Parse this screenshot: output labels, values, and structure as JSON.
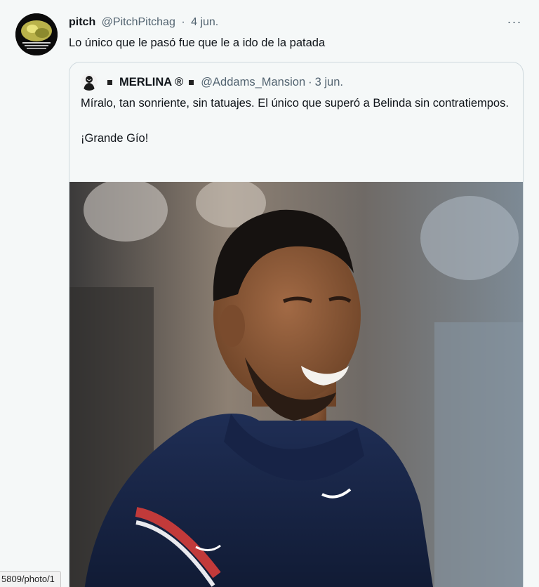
{
  "tweet": {
    "author_name": "pitch",
    "author_handle": "@PitchPitchag",
    "separator": "·",
    "date": "4 jun.",
    "text": "Lo único que le pasó fue que le a ido de la patada",
    "more_icon": "more-horizontal-icon",
    "more_label": "···"
  },
  "quote": {
    "author_name": "MERLINA ®",
    "author_handle": "@Addams_Mansion",
    "separator": "·",
    "date": "3 jun.",
    "lines": [
      "Míralo, tan sonriente, sin tatuajes. El único que superó a Belinda sin contratiempos."
    ],
    "closing": "¡Grande Gío!"
  },
  "status_bar": {
    "url": "5809/photo/1"
  },
  "colors": {
    "text": "#0f1419",
    "secondary": "#536471",
    "border": "#cfd9de",
    "background": "#f5f8f8"
  }
}
